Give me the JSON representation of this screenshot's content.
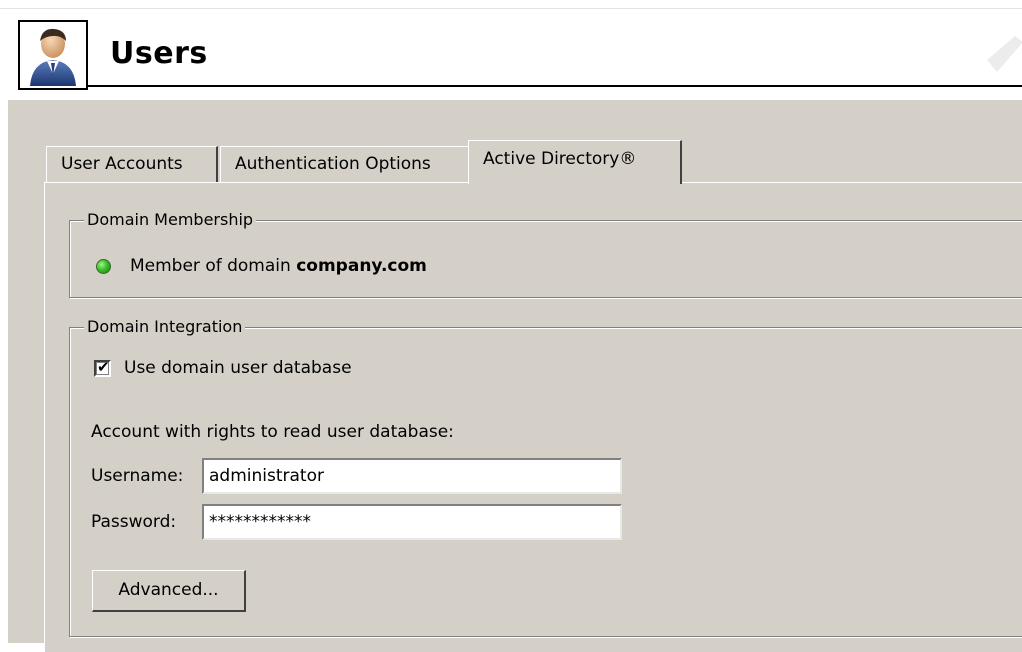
{
  "page": {
    "title": "Users",
    "icon": "user-icon"
  },
  "tabs": [
    {
      "label": "User Accounts",
      "selected": false
    },
    {
      "label": "Authentication Options",
      "selected": false
    },
    {
      "label": "Active Directory®",
      "selected": true
    }
  ],
  "domain_membership": {
    "legend": "Domain Membership",
    "status_icon": "green-status-icon",
    "status_color": "#3cbf2b",
    "text_prefix": "Member of domain ",
    "domain": "company.com"
  },
  "domain_integration": {
    "legend": "Domain Integration",
    "use_domain_db": {
      "label": "Use domain user database",
      "checked": true
    },
    "account_label": "Account with rights to read user database:",
    "username": {
      "label": "Username:",
      "value": "administrator"
    },
    "password": {
      "label": "Password:",
      "value": "************"
    },
    "advanced_button": "Advanced..."
  }
}
